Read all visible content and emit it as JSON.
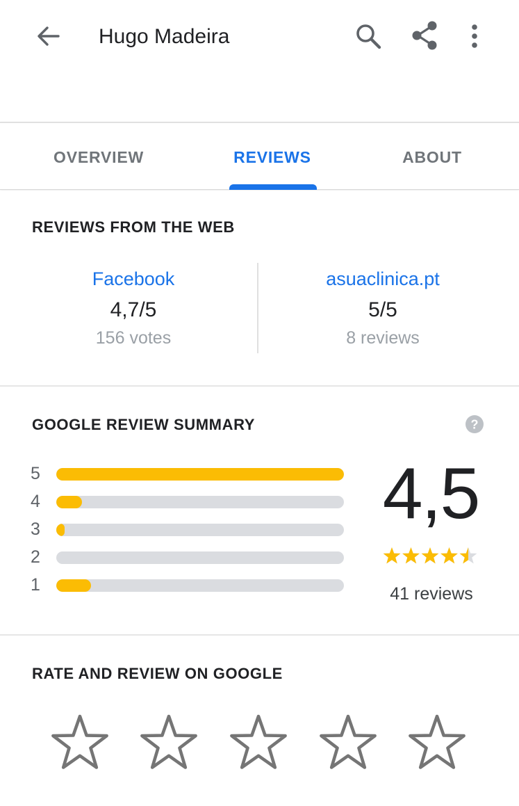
{
  "appbar": {
    "title": "Hugo Madeira",
    "icons": [
      "arrow-back-icon",
      "search-icon",
      "share-icon",
      "more-vert-icon"
    ]
  },
  "tabs": [
    {
      "label": "OVERVIEW",
      "active": false
    },
    {
      "label": "REVIEWS",
      "active": true
    },
    {
      "label": "ABOUT",
      "active": false
    }
  ],
  "web_reviews": {
    "title": "REVIEWS FROM THE WEB",
    "sources": [
      {
        "name": "Facebook",
        "score": "4,7/5",
        "count": "156 votes"
      },
      {
        "name": "asuaclinica.pt",
        "score": "5/5",
        "count": "8 reviews"
      }
    ]
  },
  "summary": {
    "title": "GOOGLE REVIEW SUMMARY",
    "help_icon": "help-icon",
    "distribution": [
      {
        "stars": "5",
        "fraction": 1.0
      },
      {
        "stars": "4",
        "fraction": 0.09
      },
      {
        "stars": "3",
        "fraction": 0.03
      },
      {
        "stars": "2",
        "fraction": 0.0
      },
      {
        "stars": "1",
        "fraction": 0.12
      }
    ],
    "average": "4,5",
    "star_rating": 4.5,
    "reviews_count": "41 reviews"
  },
  "rate": {
    "title": "RATE AND REVIEW ON GOOGLE",
    "star_count": 5
  },
  "colors": {
    "accent": "#1a73e8",
    "star": "#fbbc04",
    "track": "#dadce0",
    "muted": "#9aa0a6",
    "outline_star": "#757575"
  }
}
